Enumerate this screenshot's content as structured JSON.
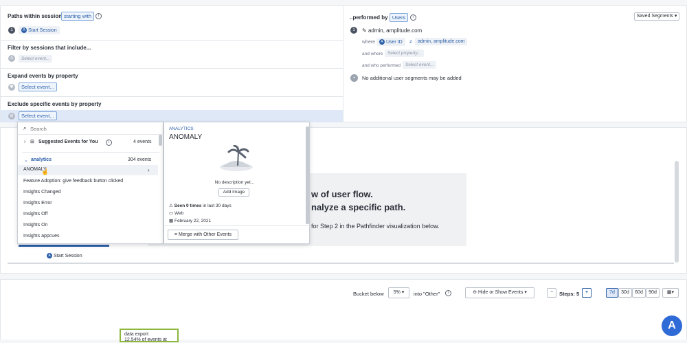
{
  "paths": {
    "title": "Paths within sessions",
    "mode_chip": "starting with",
    "step_number": "1",
    "step_event": "Start Session"
  },
  "filter": {
    "title": "Filter by sessions that include...",
    "placeholder": "Select event..."
  },
  "expand": {
    "title": "Expand events by property",
    "placeholder": "Select event..."
  },
  "exclude": {
    "title": "Exclude specific events by property",
    "placeholder": "Select event..."
  },
  "performed": {
    "title": "..performed by",
    "users_chip": "Users",
    "saved_segments": "Saved Segments",
    "segment_number": "1",
    "segment_name": "admin, amplitude.com",
    "where_label": "where",
    "user_id_chip": "User ID",
    "value_chip": "admin, amplitude.com",
    "and_where_label": "and where",
    "property_placeholder": "Select property...",
    "who_performed_label": "and who performed",
    "event_placeholder": "Select event...",
    "no_more_segments": "No additional user segments may be added"
  },
  "dropdown": {
    "search_placeholder": "Search",
    "suggested_label": "Suggested Events for You",
    "suggested_count": "4 events",
    "category_label": "analytics",
    "category_count": "304 events",
    "items": [
      "ANOMALY",
      "Feature Adoption: give feedback button clicked",
      "Insights Changed",
      "Insights Error",
      "Insights Off",
      "Insights On",
      "Insights appcues"
    ]
  },
  "detail": {
    "category": "ANALYTICS",
    "name": "ANOMALY",
    "no_description": "No description yet...",
    "add_image": "Add Image",
    "seen_bold": "Seen 0 times",
    "seen_rest": "in last 30 days",
    "platform": "Web",
    "date": "February 22, 2021",
    "merge_button": "Merge with Other Events"
  },
  "chart_area": {
    "heading_line1": "w of user flow.",
    "heading_line2": "nalyze a specific path.",
    "hint": "for Step 2 in the Pathfinder visualization below.",
    "start_label": "Start Session"
  },
  "controls": {
    "bucket_label": "Bucket below",
    "bucket_value": "5%",
    "into_other": "into \"Other\"",
    "hide_show": "Hide or Show Events",
    "minus": "−",
    "steps_label": "Steps: 5",
    "plus": "+",
    "ranges": [
      "7d",
      "30d",
      "60d",
      "90d"
    ],
    "active_range": "7d"
  },
  "node": {
    "title": "data export",
    "subtitle": "12.54% of events at"
  },
  "colors": {
    "accent": "#2c5fa8",
    "node_border": "#8ab73c",
    "help_button": "#2f6bd6"
  }
}
